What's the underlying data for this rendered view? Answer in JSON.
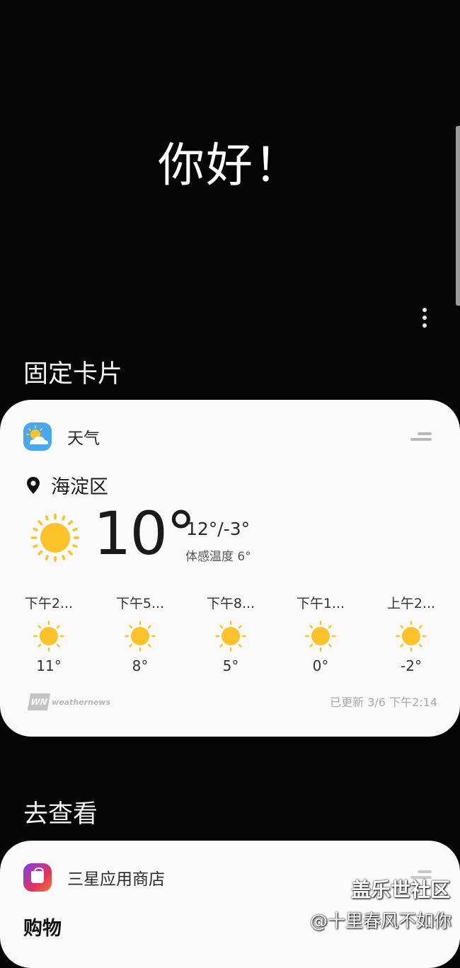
{
  "greeting": "你好！",
  "sections": {
    "pinned_title": "固定卡片",
    "explore_title": "去查看"
  },
  "weather_card": {
    "app_name": "天气",
    "app_icon": "weather-app-icon",
    "location": "海淀区",
    "current_temp": "10°",
    "hi_lo": "12°/-3°",
    "feels_like": "体感温度 6°",
    "hourly": [
      {
        "time": "下午2...",
        "temp": "11°",
        "icon": "sunny-icon"
      },
      {
        "time": "下午5...",
        "temp": "8°",
        "icon": "sunny-icon"
      },
      {
        "time": "下午8...",
        "temp": "5°",
        "icon": "sunny-icon"
      },
      {
        "time": "下午1...",
        "temp": "0°",
        "icon": "sunny-icon"
      },
      {
        "time": "上午2...",
        "temp": "-2°",
        "icon": "sunny-icon"
      }
    ],
    "provider_logo": "WN",
    "provider": "weathernews",
    "updated": "已更新 3/6 下午2:14"
  },
  "store_card": {
    "app_name": "三星应用商店",
    "category": "购物"
  },
  "watermark": {
    "title": "盖乐世社区",
    "user": "@十里春风不如你"
  },
  "colors": {
    "background": "#050505",
    "card": "#fafafa",
    "sun": "#fcc227",
    "weather_icon": "#4aa8f0"
  }
}
